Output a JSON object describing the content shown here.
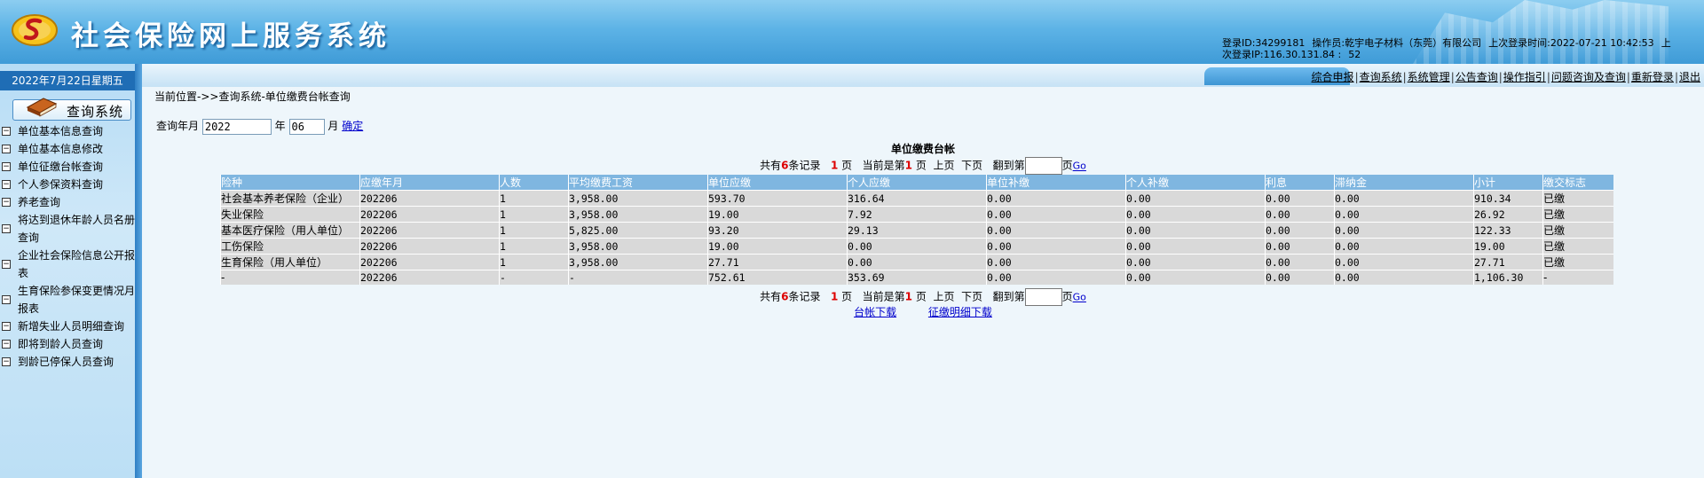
{
  "header": {
    "system_title": "社会保险网上服务系统",
    "login_id": "登录ID:34299181",
    "operator": "操作员:乾宇电子材料（东莞）有限公司",
    "last_login_time": "上次登录时间:2022-07-21 10:42:53",
    "last_login_ip_prefix": "上",
    "last_login_ip": "次登录IP:116.30.131.84 :",
    "last_login_ip_port": "52"
  },
  "topnav": {
    "items": [
      "综合申报",
      "查询系统",
      "系统管理",
      "公告查询",
      "操作指引",
      "问题咨询及查询",
      "重新登录",
      "退出"
    ]
  },
  "sidebar": {
    "date": "2022年7月22日星期五",
    "module_label": "查询系统",
    "items": [
      "单位基本信息查询",
      "单位基本信息修改",
      "单位征缴台帐查询",
      "个人参保资料查询",
      "养老查询",
      "将达到退休年龄人员名册查询",
      "企业社会保险信息公开报表",
      "生育保险参保变更情况月报表",
      "新增失业人员明细查询",
      "即将到龄人员查询",
      "到龄已停保人员查询"
    ]
  },
  "main": {
    "breadcrumb": "当前位置->>查询系统-单位缴费台帐查询",
    "query": {
      "label": "查询年月",
      "year_value": "2022",
      "year_unit": "年",
      "month_value": "06",
      "month_unit": "月",
      "confirm_label": "确定"
    },
    "table_title": "单位缴费台帐",
    "pager": {
      "prefix": "共有",
      "record_count": "6",
      "records_suffix": "条记录",
      "total_pages": "1",
      "page_unit": "页",
      "current_prefix": "当前是第",
      "current_page": "1",
      "current_suffix": "页",
      "prev_label": "上页",
      "next_label": "下页",
      "jump_prefix": "翻到第",
      "jump_suffix": "页",
      "go_label": "Go"
    },
    "table": {
      "columns": [
        "险种",
        "应缴年月",
        "人数",
        "平均缴费工资",
        "单位应缴",
        "个人应缴",
        "单位补缴",
        "个人补缴",
        "利息",
        "滞纳金",
        "小计",
        "缴交标志"
      ],
      "rows": [
        [
          "社会基本养老保险（企业）",
          "202206",
          "1",
          "3,958.00",
          "593.70",
          "316.64",
          "0.00",
          "0.00",
          "0.00",
          "0.00",
          "910.34",
          "已缴"
        ],
        [
          "失业保险",
          "202206",
          "1",
          "3,958.00",
          "19.00",
          "7.92",
          "0.00",
          "0.00",
          "0.00",
          "0.00",
          "26.92",
          "已缴"
        ],
        [
          "基本医疗保险（用人单位）",
          "202206",
          "1",
          "5,825.00",
          "93.20",
          "29.13",
          "0.00",
          "0.00",
          "0.00",
          "0.00",
          "122.33",
          "已缴"
        ],
        [
          "工伤保险",
          "202206",
          "1",
          "3,958.00",
          "19.00",
          "0.00",
          "0.00",
          "0.00",
          "0.00",
          "0.00",
          "19.00",
          "已缴"
        ],
        [
          "生育保险（用人单位）",
          "202206",
          "1",
          "3,958.00",
          "27.71",
          "0.00",
          "0.00",
          "0.00",
          "0.00",
          "0.00",
          "27.71",
          "已缴"
        ],
        [
          "-",
          "202206",
          "-",
          "-",
          "752.61",
          "353.69",
          "0.00",
          "0.00",
          "0.00",
          "0.00",
          "1,106.30",
          "-"
        ]
      ]
    },
    "downloads": {
      "ledger_download": "台帐下载",
      "detail_download": "征缴明细下载"
    }
  }
}
